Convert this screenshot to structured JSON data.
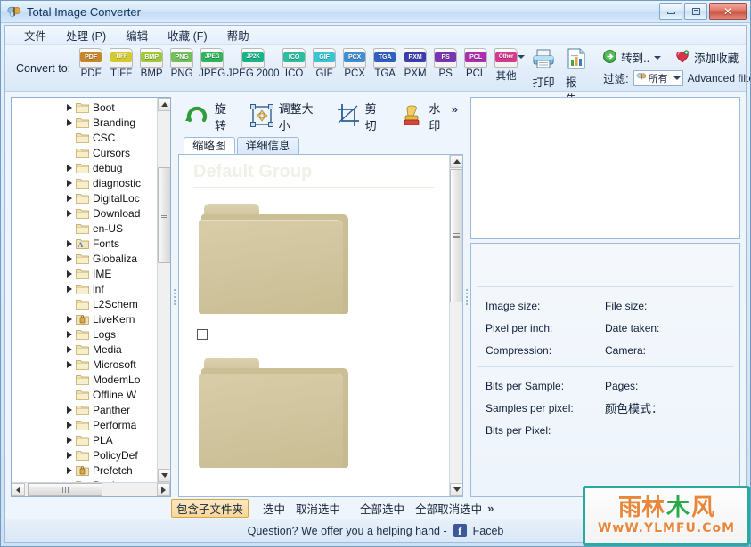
{
  "window": {
    "title": "Total Image Converter",
    "icon": "butterfly-icon",
    "buttons": {
      "minimize": "minimize-icon",
      "maximize": "maximize-icon",
      "close": "✕"
    }
  },
  "menu": {
    "items": [
      {
        "label": "文件"
      },
      {
        "label": "处理 (P)"
      },
      {
        "label": "编辑"
      },
      {
        "label": "收藏 (F)"
      },
      {
        "label": "帮助"
      }
    ]
  },
  "toolbar": {
    "convert_to_label": "Convert to:",
    "formats": [
      {
        "tag": "PDF",
        "cap": "PDF",
        "color": "#c8862b"
      },
      {
        "tag": "TIFF",
        "cap": "TIFF",
        "color": "#d4c92e"
      },
      {
        "tag": "BMP",
        "cap": "BMP",
        "color": "#9fc83b"
      },
      {
        "tag": "PNG",
        "cap": "PNG",
        "color": "#72c05a"
      },
      {
        "tag": "JPEG",
        "cap": "JPEG",
        "color": "#2fb45c"
      },
      {
        "tag": "JP2K",
        "cap": "JPEG 2000",
        "color": "#18b488"
      },
      {
        "tag": "ICO",
        "cap": "ICO",
        "color": "#2fbda0"
      },
      {
        "tag": "GIF",
        "cap": "GIF",
        "color": "#3bc4d4"
      },
      {
        "tag": "PCX",
        "cap": "PCX",
        "color": "#3f8fd4"
      },
      {
        "tag": "TGA",
        "cap": "TGA",
        "color": "#2f5fc0"
      },
      {
        "tag": "PXM",
        "cap": "PXM",
        "color": "#3b3fae"
      },
      {
        "tag": "PS",
        "cap": "PS",
        "color": "#7a35b0"
      },
      {
        "tag": "PCL",
        "cap": "PCL",
        "color": "#ad2fae"
      },
      {
        "tag": "Other",
        "cap": "其他",
        "color": "#d63a8e"
      }
    ],
    "print": {
      "label": "打印",
      "icon": "printer-icon"
    },
    "report": {
      "label": "报告",
      "icon": "report-icon"
    },
    "goto": {
      "label": "转到..",
      "icon": "goto-arrow-icon"
    },
    "add_favorite": {
      "label": "添加收藏",
      "icon": "heart-icon"
    },
    "filter_label": "过滤:",
    "filter_value": "所有",
    "advanced_filter": "Advanced filter"
  },
  "edit_toolbar": {
    "rotate": {
      "label": "旋转",
      "icon": "rotate-icon"
    },
    "resize": {
      "label": "调整大小",
      "icon": "resize-icon"
    },
    "crop": {
      "label": "剪切",
      "icon": "crop-icon"
    },
    "watermark": {
      "label": "水印",
      "icon": "stamp-icon"
    },
    "more": "»"
  },
  "tabs": [
    {
      "label": "缩略图",
      "active": true
    },
    {
      "label": "详细信息",
      "active": false
    }
  ],
  "tree": {
    "items": [
      {
        "label": "Boot",
        "expandable": true,
        "icon": "folder-icon"
      },
      {
        "label": "Branding",
        "expandable": true,
        "icon": "folder-icon"
      },
      {
        "label": "CSC",
        "expandable": false,
        "icon": "folder-icon"
      },
      {
        "label": "Cursors",
        "expandable": false,
        "icon": "folder-icon"
      },
      {
        "label": "debug",
        "expandable": true,
        "icon": "folder-icon"
      },
      {
        "label": "diagnostic",
        "expandable": true,
        "icon": "folder-icon"
      },
      {
        "label": "DigitalLoc",
        "expandable": true,
        "icon": "folder-icon"
      },
      {
        "label": "Download",
        "expandable": true,
        "icon": "folder-icon"
      },
      {
        "label": "en-US",
        "expandable": false,
        "icon": "folder-icon"
      },
      {
        "label": "Fonts",
        "expandable": true,
        "icon": "folder-font-icon"
      },
      {
        "label": "Globaliza",
        "expandable": true,
        "icon": "folder-icon"
      },
      {
        "label": "IME",
        "expandable": true,
        "icon": "folder-icon"
      },
      {
        "label": "inf",
        "expandable": true,
        "icon": "folder-icon"
      },
      {
        "label": "L2Schem",
        "expandable": false,
        "icon": "folder-icon"
      },
      {
        "label": "LiveKern",
        "expandable": true,
        "icon": "folder-locked-icon"
      },
      {
        "label": "Logs",
        "expandable": true,
        "icon": "folder-icon"
      },
      {
        "label": "Media",
        "expandable": true,
        "icon": "folder-icon"
      },
      {
        "label": "Microsoft",
        "expandable": true,
        "icon": "folder-icon"
      },
      {
        "label": "ModemLo",
        "expandable": false,
        "icon": "folder-icon"
      },
      {
        "label": "Offline W",
        "expandable": false,
        "icon": "folder-icon"
      },
      {
        "label": "Panther",
        "expandable": true,
        "icon": "folder-icon"
      },
      {
        "label": "Performa",
        "expandable": true,
        "icon": "folder-icon"
      },
      {
        "label": "PLA",
        "expandable": true,
        "icon": "folder-icon"
      },
      {
        "label": "PolicyDef",
        "expandable": true,
        "icon": "folder-icon"
      },
      {
        "label": "Prefetch",
        "expandable": true,
        "icon": "folder-locked-icon"
      },
      {
        "label": "Registere",
        "expandable": false,
        "icon": "folder-icon"
      }
    ]
  },
  "thumbnails": {
    "group_title": "Default Group",
    "items": [
      {
        "type": "folder",
        "checked": false
      },
      {
        "type": "folder",
        "checked": false
      }
    ]
  },
  "info": {
    "rows_top": [
      {
        "left": "Image size:",
        "right": "File size:"
      },
      {
        "left": "Pixel per inch:",
        "right": "Date taken:"
      },
      {
        "left": "Compression:",
        "right": "Camera:"
      }
    ],
    "rows_bottom": [
      {
        "left": "Bits per Sample:",
        "right": "Pages:"
      },
      {
        "left": "Samples per pixel:",
        "right": "颜色模式："
      },
      {
        "left": "Bits per Pixel:",
        "right": ""
      }
    ]
  },
  "selection_bar": {
    "buttons": [
      {
        "label": "包含子文件夹",
        "active": true
      },
      {
        "label": "选中",
        "active": false
      },
      {
        "label": "取消选中",
        "active": false
      },
      {
        "label": "全部选中",
        "active": false
      },
      {
        "label": "全部取消选中",
        "active": false
      }
    ],
    "more": "»"
  },
  "statusbar": {
    "text": "Question? We offer you a helping hand -",
    "facebook_label": "Faceb",
    "facebook_icon": "facebook-icon"
  },
  "watermark": {
    "cn_part1": "雨林",
    "cn_leaf": "木",
    "cn_part2": "风",
    "url": "WwW.YLMFU.CoM",
    "border_color": "#2aa9a0",
    "text_color": "#e8863a"
  }
}
